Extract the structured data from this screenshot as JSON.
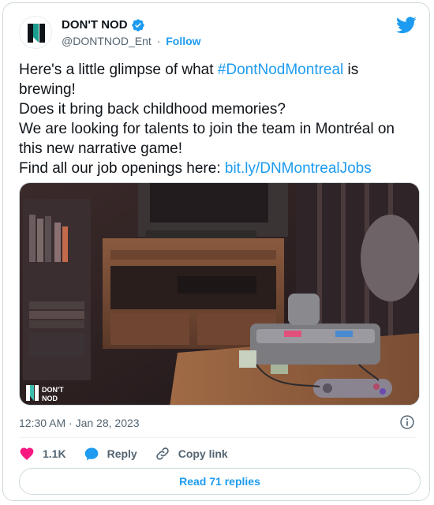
{
  "account": {
    "display_name": "DON'T NOD",
    "handle": "@DONTNOD_Ent",
    "separator": "·",
    "follow_label": "Follow"
  },
  "tweet": {
    "lines": [
      {
        "before": "Here's a little glimpse of what ",
        "link": "#DontNodMontreal",
        "after": " is"
      },
      {
        "before": "brewing!",
        "link": "",
        "after": ""
      },
      {
        "before": "Does it bring back childhood memories?",
        "link": "",
        "after": ""
      },
      {
        "before": "We are looking for talents to join the team in Montréal on",
        "link": "",
        "after": ""
      },
      {
        "before": "this new narrative game!",
        "link": "",
        "after": ""
      },
      {
        "before": "Find all our job openings here: ",
        "link": "bit.ly/DNMontrealJobs",
        "after": ""
      }
    ],
    "media_watermark": {
      "line1": "DON'T",
      "line2": "NOD"
    },
    "timestamp": "12:30 AM · Jan 28, 2023"
  },
  "actions": {
    "likes": "1.1K",
    "reply_label": "Reply",
    "copy_link_label": "Copy link"
  },
  "read_replies_label": "Read 71 replies",
  "colors": {
    "accent": "#1d9bf0",
    "like": "#f91880",
    "text": "#0f1419",
    "muted": "#536471",
    "border": "#cfd9de"
  }
}
